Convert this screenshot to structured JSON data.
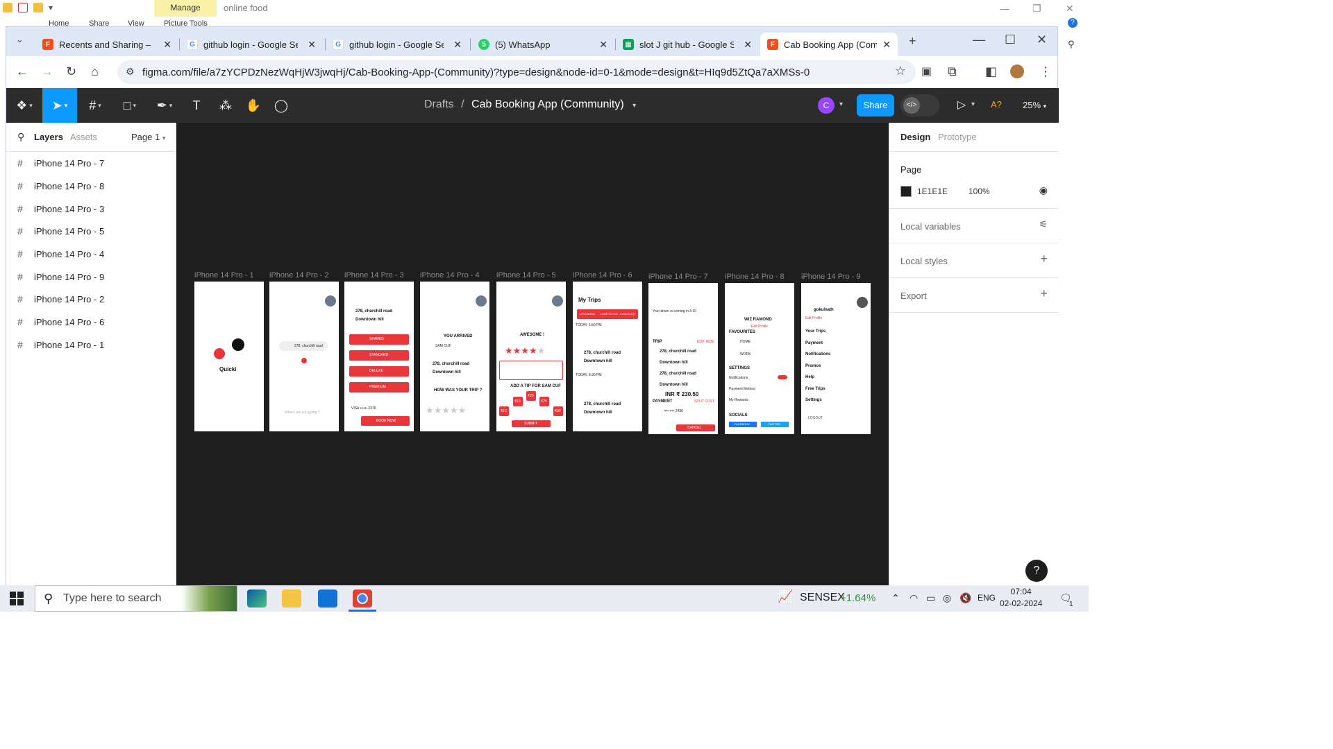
{
  "explorer": {
    "manage_tab": "Manage",
    "title": "online food",
    "ribbon": [
      "Home",
      "Share",
      "View",
      "Picture Tools"
    ]
  },
  "browser": {
    "tabs": [
      {
        "label": "Recents and Sharing – Fig",
        "icon": "figma-icon",
        "color": "#f24e1e"
      },
      {
        "label": "github login - Google Sea",
        "icon": "google-icon",
        "color": "#4285f4"
      },
      {
        "label": "github login - Google Sea",
        "icon": "google-icon",
        "color": "#4285f4"
      },
      {
        "label": "(5) WhatsApp",
        "icon": "whatsapp-icon",
        "color": "#25d366"
      },
      {
        "label": "slot J git hub - Google Sh",
        "icon": "sheets-icon",
        "color": "#0f9d58"
      },
      {
        "label": "Cab Booking App (Comm",
        "icon": "figma-icon",
        "color": "#f24e1e"
      }
    ],
    "url": "figma.com/file/a7zYCPDzNezWqHjW3jwqHj/Cab-Booking-App-(Community)?type=design&node-id=0-1&mode=design&t=HIq9d5ZtQa7aXMSs-0"
  },
  "figma": {
    "breadcrumb": {
      "project": "Drafts",
      "separator": "/",
      "file": "Cab Booking App (Community)"
    },
    "avatar_letter": "C",
    "share_label": "Share",
    "font_warning": "A?",
    "zoom": "25%",
    "left_panel": {
      "tab_layers": "Layers",
      "tab_assets": "Assets",
      "page": "Page 1",
      "layers": [
        "iPhone 14 Pro - 7",
        "iPhone 14 Pro - 8",
        "iPhone 14 Pro - 3",
        "iPhone 14 Pro - 5",
        "iPhone 14 Pro - 4",
        "iPhone 14 Pro - 9",
        "iPhone 14 Pro - 2",
        "iPhone 14 Pro - 6",
        "iPhone 14 Pro - 1"
      ]
    },
    "frames": [
      {
        "label": "iPhone 14 Pro - 1",
        "brand": "Quicki"
      },
      {
        "label": "iPhone 14 Pro - 2",
        "address": "278, churchill road",
        "search": "Where are you going ?"
      },
      {
        "label": "iPhone 14 Pro - 3",
        "from": "278, churchill road",
        "to": "Downtown hill",
        "options": [
          "SHARED",
          "STANDARD",
          "DELUXE",
          "PREMIUM"
        ],
        "card": "VISA •••••• 2376",
        "cta": "BOOK NOW"
      },
      {
        "label": "iPhone 14 Pro - 4",
        "heading": "YOU ARRIVED",
        "driver": "SAM CUF",
        "from": "278, churchill road",
        "to": "Downtown hill",
        "question": "HOW WAS YOUR TRIP ?"
      },
      {
        "label": "iPhone 14 Pro - 5",
        "heading": "AWESOME !",
        "tip_heading": "ADD A TIP FOR SAM CUF",
        "tips": [
          "₹10",
          "₹15",
          "₹20",
          "₹25",
          "₹30"
        ],
        "cta": "SUBMIT"
      },
      {
        "label": "iPhone 14 Pro - 6",
        "heading": "My Trips",
        "tabs": [
          "UPCOMING",
          "COMPLETED",
          "CANCELED"
        ],
        "day1": "TODAY, 6:50 PM",
        "day2": "TODAY, 8:30 PM",
        "from": "278, churchill road",
        "to": "Downtown hill"
      },
      {
        "label": "iPhone 14 Pro - 7",
        "heading": "Your driver is coming in 3:10",
        "trip": "TRIP",
        "edit": "EDIT RIDE",
        "stops": [
          "278, churchill road",
          "Downtown hill",
          "278, churchill road",
          "Downtown hill"
        ],
        "amount": "INR ₹ 230.50",
        "payment": "PAYMENT",
        "split": "SPLIT COST",
        "card": "•••• •••• 2436",
        "cta": "CANCEL"
      },
      {
        "label": "iPhone 14 Pro - 8",
        "name": "WIZ RAMOND",
        "edit": "Edit Profile",
        "favourites": "FAVOURITES",
        "home": "HOME",
        "work": "WORK",
        "settings": "SETTINGS",
        "notifications": "Notifications",
        "payment_method": "Payment Method",
        "rewards": "My Rewards",
        "socials": "SOCIALS",
        "facebook": "FACEBOOK",
        "twitter": "TWITTER"
      },
      {
        "label": "iPhone 14 Pro - 9",
        "name": "gokulnath",
        "edit": "Edit Profile",
        "menu": [
          "Your Trips",
          "Payment",
          "Notifications",
          "Promos",
          "Help",
          "Free Trips",
          "Settings"
        ],
        "logout": "LOGOUT"
      }
    ],
    "right_panel": {
      "tab_design": "Design",
      "tab_prototype": "Prototype",
      "page_title": "Page",
      "page_color": "1E1E1E",
      "page_opacity": "100%",
      "local_variables": "Local variables",
      "local_styles": "Local styles",
      "export": "Export"
    },
    "help": "?"
  },
  "taskbar": {
    "search_placeholder": "Type here to search",
    "ticker": "SENSEX",
    "ticker_change": "+1.64%",
    "lang": "ENG",
    "time": "07:04",
    "date": "02-02-2024",
    "notifications": "1"
  }
}
